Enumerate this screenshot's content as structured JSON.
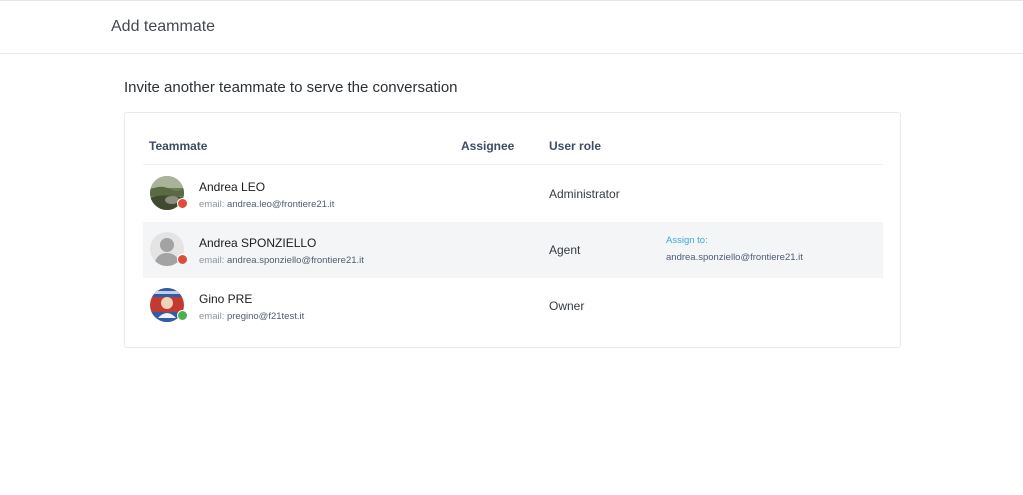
{
  "header": {
    "title": "Add teammate"
  },
  "subtitle": "Invite another teammate to serve the conversation",
  "table": {
    "columns": {
      "teammate": "Teammate",
      "assignee": "Assignee",
      "role": "User role"
    },
    "rows": [
      {
        "name": "Andrea LEO",
        "email_prefix": "email: ",
        "email": "andrea.leo@frontiere21.it",
        "role": "Administrator",
        "status_color": "#e04b3a",
        "avatar": "landscape-photo"
      },
      {
        "name": "Andrea SPONZIELLO",
        "email_prefix": "email: ",
        "email": "andrea.sponziello@frontiere21.it",
        "role": "Agent",
        "status_color": "#e04b3a",
        "avatar": "default-user",
        "assign_label": "Assign to:",
        "assign_email": "andrea.sponziello@frontiere21.it"
      },
      {
        "name": "Gino PRE",
        "email_prefix": "email: ",
        "email": "pregino@f21test.it",
        "role": "Owner",
        "status_color": "#4caf50",
        "avatar": "photo"
      }
    ]
  },
  "colors": {
    "accent": "#3fa8d6",
    "header_text": "#3e4b61",
    "row_highlight": "#f4f5f6"
  }
}
